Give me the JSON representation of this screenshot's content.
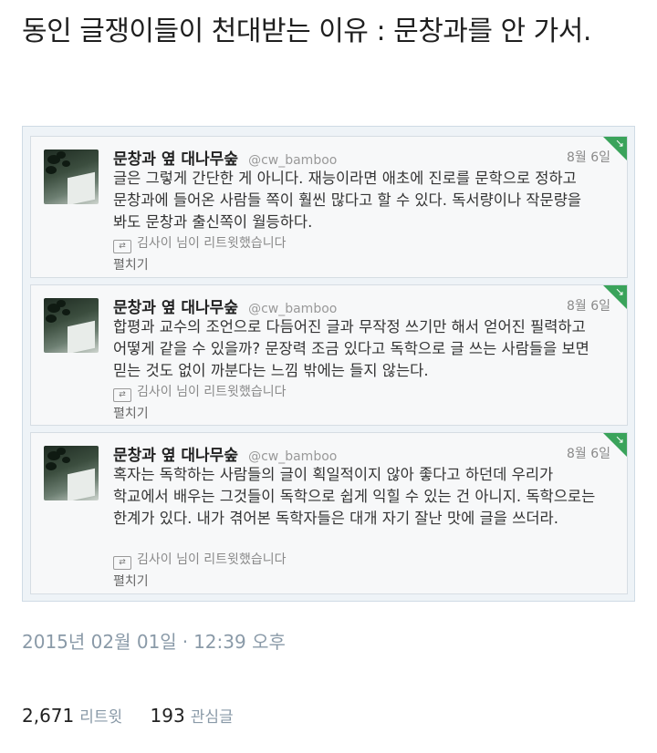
{
  "post_title": "동인 글쟁이들이 천대받는 이유 : 문창과를 안 가서.",
  "tweets": [
    {
      "name": "문창과 옆 대나무숲",
      "handle": "@cw_bamboo",
      "date": "8월 6일",
      "text": "글은 그렇게 간단한 게 아니다. 재능이라면 애초에 진로를 문학으로 정하고 문창과에 들어온 사람들 쪽이 훨씬 많다고 할 수 있다. 독서량이나 작문량을 봐도 문창과 출신쪽이 월등하다.",
      "retweet_note": "김사이 님이 리트윗했습니다",
      "expand": "펼치기"
    },
    {
      "name": "문창과 옆 대나무숲",
      "handle": "@cw_bamboo",
      "date": "8월 6일",
      "text": "합평과 교수의 조언으로 다듬어진 글과 무작정 쓰기만 해서 얻어진 필력하고 어떻게 같을 수 있을까? 문장력 조금 있다고 독학으로 글 쓰는 사람들을 보면 믿는 것도 없이 까분다는 느낌 밖에는 들지 않는다.",
      "retweet_note": "김사이 님이 리트윗했습니다",
      "expand": "펼치기"
    },
    {
      "name": "문창과 옆 대나무숲",
      "handle": "@cw_bamboo",
      "date": "8월 6일",
      "text": "혹자는 독학하는 사람들의 글이 획일적이지 않아 좋다고 하던데 우리가 학교에서 배우는 그것들이 독학으로 쉽게 익힐 수 있는 건 아니지. 독학으로는 한계가 있다. 내가 겪어본 독학자들은 대개 자기 잘난 맛에 글을 쓰더라.",
      "retweet_note": "김사이 님이 리트윗했습니다",
      "expand": "펼치기"
    }
  ],
  "meta": {
    "date": "2015년 02월 01일",
    "separator": "·",
    "time": "12:39 오후"
  },
  "stats": {
    "retweets_count": "2,671",
    "retweets_label": "리트윗",
    "likes_count": "193",
    "likes_label": "관심글"
  },
  "icons": {
    "retweet": "retweet-icon",
    "corner": "retweet-corner-icon"
  },
  "colors": {
    "accent_green": "#3aa35b",
    "meta_gray": "#8a9aa8"
  }
}
